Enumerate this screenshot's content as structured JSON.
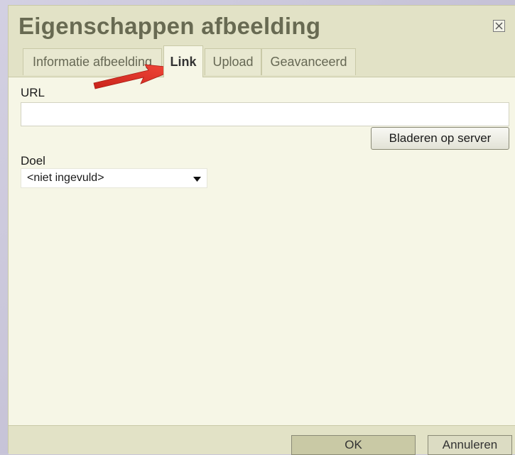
{
  "dialog": {
    "title": "Eigenschappen afbeelding",
    "tabs": [
      {
        "label": "Informatie afbeelding"
      },
      {
        "label": "Link"
      },
      {
        "label": "Upload"
      },
      {
        "label": "Geavanceerd"
      }
    ],
    "active_tab": "Link"
  },
  "link": {
    "url_label": "URL",
    "url_value": "",
    "browse_label": "Bladeren op server",
    "target_label": "Doel",
    "target_value": "<niet ingevuld>"
  },
  "footer": {
    "ok_label": "OK",
    "cancel_label": "Annuleren"
  },
  "icons": {
    "close": "close-icon",
    "dropdown": "chevron-down-icon",
    "annotation": "red-arrow-icon"
  },
  "colors": {
    "title": "#686a52",
    "panel": "#f6f6e6",
    "header": "#e2e2c6",
    "annotation_arrow": "#e8372a"
  }
}
